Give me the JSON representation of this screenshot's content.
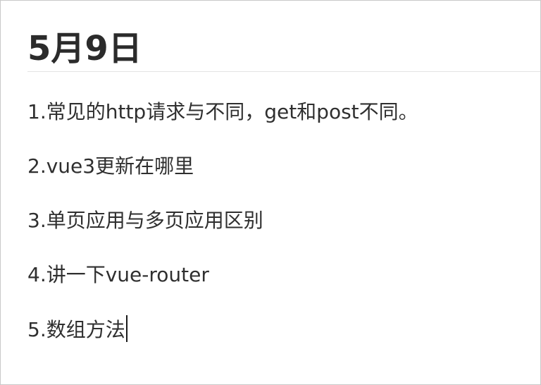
{
  "document": {
    "title": "5月9日",
    "lines": [
      "1.常见的http请求与不同，get和post不同。",
      "2.vue3更新在哪里",
      "3.单页应用与多页应用区别",
      "4.讲一下vue-router",
      "5.数组方法"
    ]
  }
}
